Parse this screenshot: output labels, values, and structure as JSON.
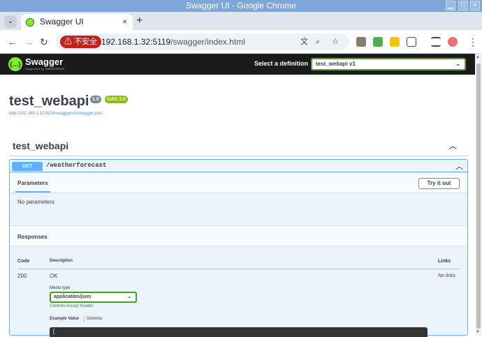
{
  "window": {
    "title": "Swagger UI - Google Chrome"
  },
  "tab": {
    "title": "Swagger UI",
    "close": "×",
    "new_tab": "+"
  },
  "address": {
    "security_label": "不安全",
    "url_host": "192.168.1.32:5119",
    "url_path": "/swagger/index.html"
  },
  "swagger_bar": {
    "logo_name": "Swagger",
    "logo_sub": "Supported by SMARTBEAR",
    "select_label": "Select a definition",
    "selected_definition": "test_webapi v1"
  },
  "info": {
    "title": "test_webapi",
    "version": "1.0",
    "oas": "OAS 3.0",
    "spec_url": "http://192.168.1.32:5119/swagger/v1/swagger.json"
  },
  "tag": {
    "name": "test_webapi"
  },
  "operation": {
    "method": "GET",
    "path": "/weatherforecast",
    "parameters_tab": "Parameters",
    "try_button": "Try it out",
    "no_parameters": "No parameters",
    "responses_title": "Responses",
    "columns": {
      "code": "Code",
      "description": "Description",
      "links": "Links"
    },
    "responses": [
      {
        "code": "200",
        "description": "OK",
        "links": "No links",
        "media_type_label": "Media type",
        "media_type": "application/json",
        "controls_note": "Controls Accept header.",
        "example_tab": "Example Value",
        "schema_tab": "Schema",
        "code_start": "["
      }
    ]
  },
  "colors": {
    "get": "#61affe",
    "swagger_green": "#85ea2d",
    "topbar": "#1b1b1b"
  }
}
